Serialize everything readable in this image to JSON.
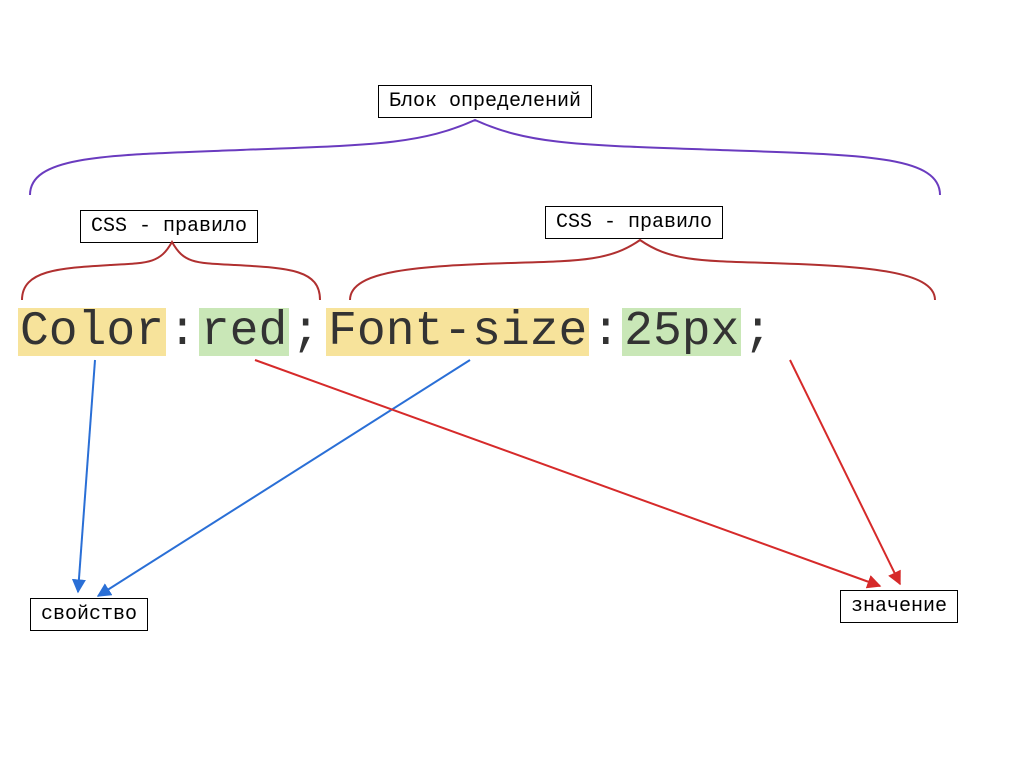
{
  "labels": {
    "block": "Блок определений",
    "rule1": "CSS - правило",
    "rule2": "CSS - правило",
    "property": "свойство",
    "value": "значение"
  },
  "code": {
    "property1": "Color",
    "colon1": ":",
    "value1": "red",
    "semi1": ";",
    "space": " ",
    "property2": "Font-size",
    "colon2": ":",
    "value2": "25px",
    "semi2": ";"
  },
  "colors": {
    "topBrace": "#6a3bbf",
    "ruleBrace": "#b03030",
    "propArrow": "#2a6fd6",
    "valueArrow": "#d62a2a",
    "propHighlight": "#f7e39b",
    "valHighlight": "#c9e7b7"
  }
}
